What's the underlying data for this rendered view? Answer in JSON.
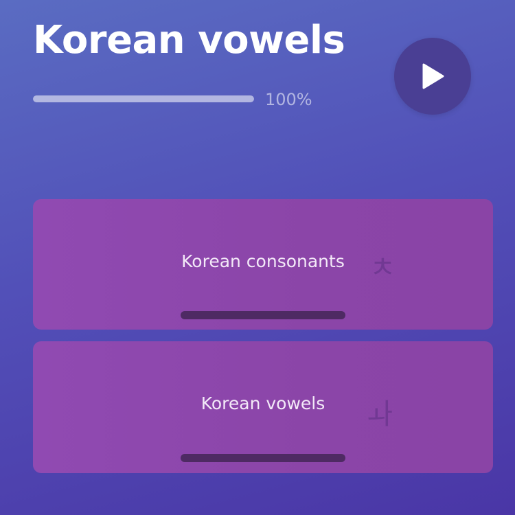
{
  "header": {
    "title": "Korean vowels",
    "progress_text": "100%",
    "progress_fraction": 1.0
  },
  "play_button": {
    "icon": "play-icon"
  },
  "cards": [
    {
      "label": "Korean consonants",
      "glyph": "ㅊ"
    },
    {
      "label": "Korean vowels",
      "glyph": "ㅘ"
    }
  ],
  "colors": {
    "background_top": "#5a6cc2",
    "background_bottom": "#4a36a6",
    "card": "#8d47ab",
    "card_bar": "#4e2a63",
    "play_button": "#4a3f94"
  }
}
